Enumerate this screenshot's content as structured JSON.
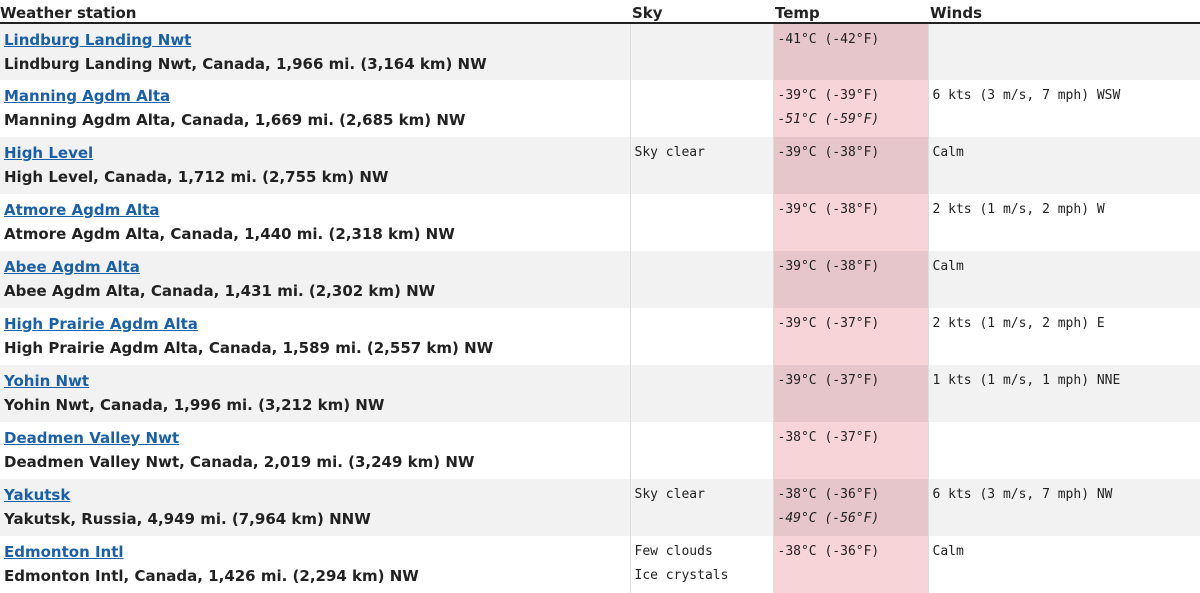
{
  "headers": {
    "station": "Weather station",
    "sky": "Sky",
    "temp": "Temp",
    "winds": "Winds"
  },
  "rows": [
    {
      "name": "Lindburg Landing Nwt",
      "desc": "Lindburg Landing Nwt, Canada, 1,966 mi. (3,164 km) NW",
      "sky1": "",
      "sky2": "",
      "temp": "-41°C (-42°F)",
      "temp_low": "",
      "winds": ""
    },
    {
      "name": "Manning Agdm Alta",
      "desc": "Manning Agdm Alta, Canada, 1,669 mi. (2,685 km) NW",
      "sky1": "",
      "sky2": "",
      "temp": "-39°C (-39°F)",
      "temp_low": "-51°C (-59°F)",
      "winds": "6 kts (3 m/s, 7 mph) WSW"
    },
    {
      "name": "High Level",
      "desc": "High Level, Canada, 1,712 mi. (2,755 km) NW",
      "sky1": "Sky clear",
      "sky2": "",
      "temp": "-39°C (-38°F)",
      "temp_low": "",
      "winds": "Calm"
    },
    {
      "name": "Atmore Agdm Alta",
      "desc": "Atmore Agdm Alta, Canada, 1,440 mi. (2,318 km) NW",
      "sky1": "",
      "sky2": "",
      "temp": "-39°C (-38°F)",
      "temp_low": "",
      "winds": "2 kts (1 m/s, 2 mph) W"
    },
    {
      "name": "Abee Agdm Alta",
      "desc": "Abee Agdm Alta, Canada, 1,431 mi. (2,302 km) NW",
      "sky1": "",
      "sky2": "",
      "temp": "-39°C (-38°F)",
      "temp_low": "",
      "winds": "Calm"
    },
    {
      "name": "High Prairie Agdm Alta",
      "desc": "High Prairie Agdm Alta, Canada, 1,589 mi. (2,557 km) NW",
      "sky1": "",
      "sky2": "",
      "temp": "-39°C (-37°F)",
      "temp_low": "",
      "winds": "2 kts (1 m/s, 2 mph) E"
    },
    {
      "name": "Yohin Nwt",
      "desc": "Yohin Nwt, Canada, 1,996 mi. (3,212 km) NW",
      "sky1": "",
      "sky2": "",
      "temp": "-39°C (-37°F)",
      "temp_low": "",
      "winds": "1 kts (1 m/s, 1 mph) NNE"
    },
    {
      "name": "Deadmen Valley Nwt",
      "desc": "Deadmen Valley Nwt, Canada, 2,019 mi. (3,249 km) NW",
      "sky1": "",
      "sky2": "",
      "temp": "-38°C (-37°F)",
      "temp_low": "",
      "winds": ""
    },
    {
      "name": "Yakutsk",
      "desc": "Yakutsk, Russia, 4,949 mi. (7,964 km) NNW",
      "sky1": "Sky clear",
      "sky2": "",
      "temp": "-38°C (-36°F)",
      "temp_low": "-49°C (-56°F)",
      "winds": "6 kts (3 m/s, 7 mph) NW"
    },
    {
      "name": "Edmonton Intl",
      "desc": "Edmonton Intl, Canada, 1,426 mi. (2,294 km) NW",
      "sky1": "Few clouds",
      "sky2": "Ice crystals",
      "temp": "-38°C (-36°F)",
      "temp_low": "",
      "winds": "Calm"
    }
  ]
}
